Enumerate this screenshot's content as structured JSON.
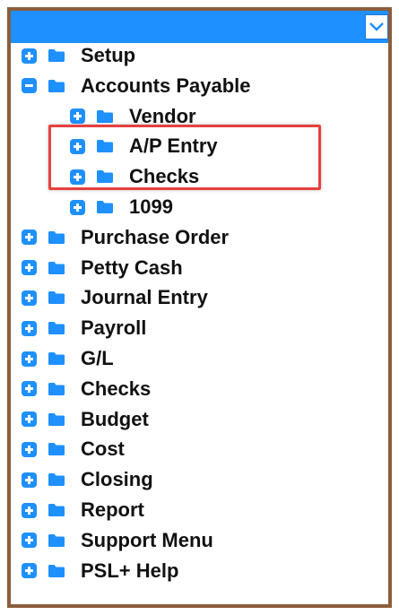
{
  "colors": {
    "header": "#1e90ff",
    "border": "#8b5e3c",
    "icon": "#1e90ff",
    "highlight": "#e5413e"
  },
  "header": {
    "dropdown_icon": "chevron-down-icon"
  },
  "tree": [
    {
      "label": "Setup",
      "expanded": false,
      "level": 0
    },
    {
      "label": "Accounts Payable",
      "expanded": true,
      "level": 0
    },
    {
      "label": "Vendor",
      "expanded": false,
      "level": 1
    },
    {
      "label": "A/P Entry",
      "expanded": false,
      "level": 1
    },
    {
      "label": "Checks",
      "expanded": false,
      "level": 1
    },
    {
      "label": "1099",
      "expanded": false,
      "level": 1
    },
    {
      "label": "Purchase Order",
      "expanded": false,
      "level": 0
    },
    {
      "label": "Petty Cash",
      "expanded": false,
      "level": 0
    },
    {
      "label": "Journal Entry",
      "expanded": false,
      "level": 0
    },
    {
      "label": "Payroll",
      "expanded": false,
      "level": 0
    },
    {
      "label": "G/L",
      "expanded": false,
      "level": 0
    },
    {
      "label": "Checks",
      "expanded": false,
      "level": 0
    },
    {
      "label": "Budget",
      "expanded": false,
      "level": 0
    },
    {
      "label": "Cost",
      "expanded": false,
      "level": 0
    },
    {
      "label": "Closing",
      "expanded": false,
      "level": 0
    },
    {
      "label": "Report",
      "expanded": false,
      "level": 0
    },
    {
      "label": "Support Menu",
      "expanded": false,
      "level": 0
    },
    {
      "label": "PSL+ Help",
      "expanded": false,
      "level": 0
    }
  ]
}
